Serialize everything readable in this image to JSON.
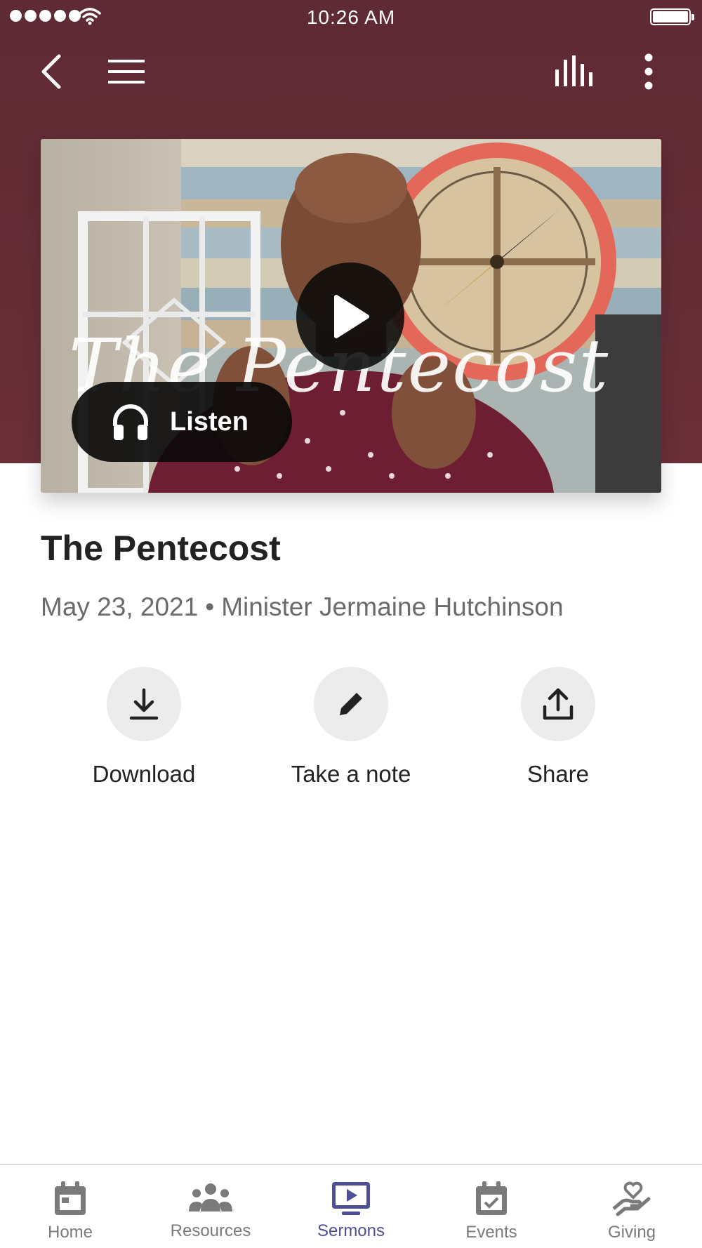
{
  "status_bar": {
    "time": "10:26 AM"
  },
  "nav": {
    "back_icon": "chevron-left-icon",
    "menu_icon": "hamburger-menu-icon",
    "audio_icon": "audio-bars-icon",
    "more_icon": "more-vertical-icon"
  },
  "media": {
    "overlay_title": "The Pentecost",
    "listen_label": "Listen",
    "play_icon": "play-icon",
    "listen_icon": "headphones-icon"
  },
  "sermon": {
    "title": "The Pentecost",
    "date": "May 23, 2021",
    "separator": "•",
    "speaker": "Minister Jermaine Hutchinson"
  },
  "actions": [
    {
      "label": "Download",
      "icon": "download-icon"
    },
    {
      "label": "Take a note",
      "icon": "pencil-icon"
    },
    {
      "label": "Share",
      "icon": "share-icon"
    }
  ],
  "tabs": [
    {
      "label": "Home",
      "icon": "calendar-icon",
      "active": false
    },
    {
      "label": "Resources",
      "icon": "people-group-icon",
      "active": false
    },
    {
      "label": "Sermons",
      "icon": "play-screen-icon",
      "active": true
    },
    {
      "label": "Events",
      "icon": "calendar-check-icon",
      "active": false
    },
    {
      "label": "Giving",
      "icon": "heart-hand-icon",
      "active": false
    }
  ],
  "colors": {
    "header": "#5e2a33",
    "active_tab": "#4f4f94",
    "inactive_tab": "#7a7a7a"
  }
}
